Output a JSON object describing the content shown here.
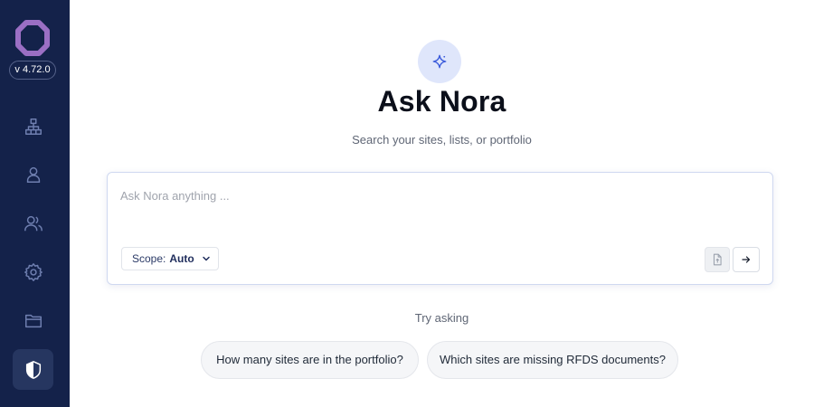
{
  "sidebar": {
    "logo_icon": "octagon-ring-logo-icon",
    "version": "v 4.72.0",
    "items": [
      {
        "icon": "sitemap-icon",
        "active": false
      },
      {
        "icon": "user-icon",
        "active": false
      },
      {
        "icon": "users-icon",
        "active": false
      },
      {
        "icon": "gear-icon",
        "active": false
      },
      {
        "icon": "folder-icon",
        "active": false
      },
      {
        "icon": "shield-icon",
        "active": true
      }
    ]
  },
  "main": {
    "hero_icon": "sparkle-icon",
    "title": "Ask Nora",
    "subtitle": "Search your sites, lists, or portfolio",
    "ask": {
      "placeholder": "Ask Nora anything ...",
      "value": "",
      "scope_label": "Scope:",
      "scope_value": "Auto",
      "attach_icon": "file-upload-icon",
      "send_icon": "arrow-right-icon"
    },
    "try_asking_label": "Try asking",
    "suggestions": [
      "How many sites are in the portfolio?",
      "Which sites are missing RFDS documents?"
    ]
  },
  "colors": {
    "sidebar_bg": "#14224a",
    "accent_purple": "#9b6fc4",
    "sidebar_icon": "#6f7fb0",
    "brand_blue": "#2b3a67"
  }
}
